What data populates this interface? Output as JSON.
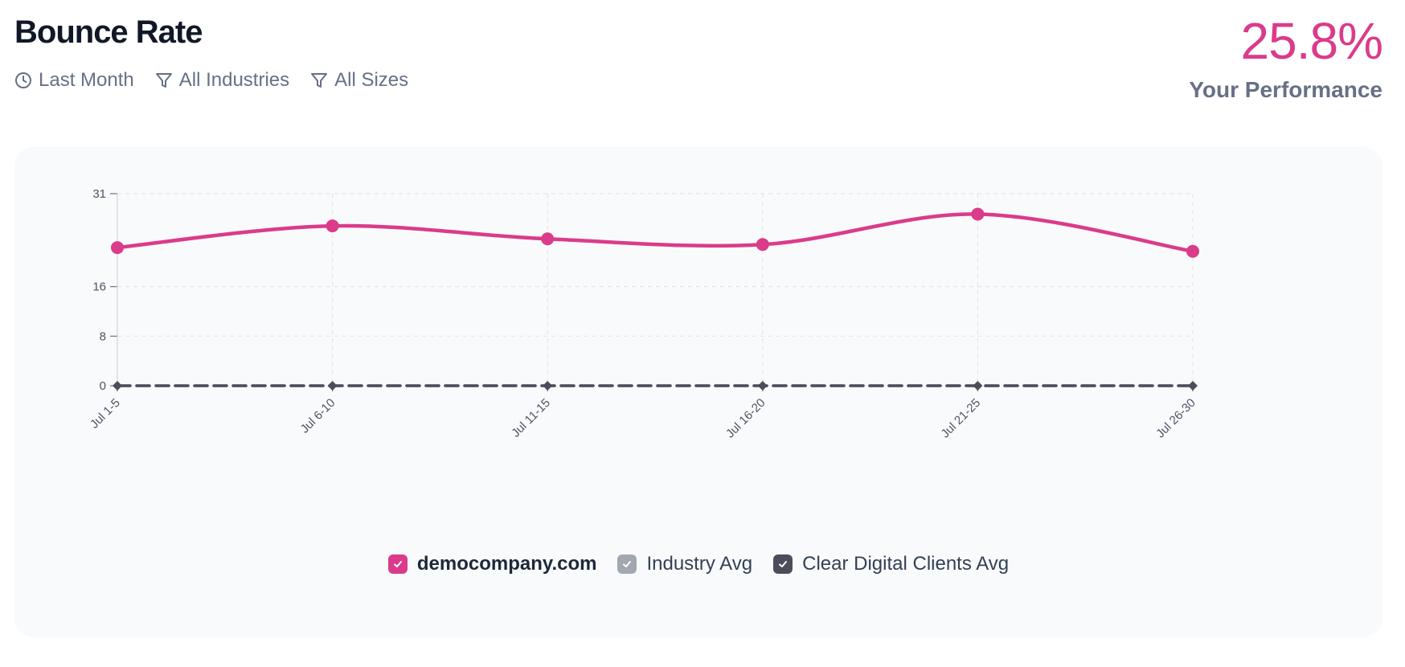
{
  "header": {
    "title": "Bounce Rate",
    "filters": {
      "period": "Last Month",
      "industry": "All Industries",
      "size": "All Sizes"
    },
    "score": "25.8%",
    "score_label": "Your Performance"
  },
  "legend": {
    "items": [
      {
        "label": "democompany.com",
        "color": "#db3b8b"
      },
      {
        "label": "Industry Avg",
        "color": "#a3a7b0"
      },
      {
        "label": "Clear Digital Clients Avg",
        "color": "#4b4e5a"
      }
    ]
  },
  "colors": {
    "accent": "#db3b8b",
    "muted_text": "#667085"
  },
  "chart_data": {
    "type": "line",
    "categories": [
      "Jul 1-5",
      "Jul 6-10",
      "Jul 11-15",
      "Jul 16-20",
      "Jul 21-25",
      "Jul 26-30"
    ],
    "yticks": [
      0,
      8,
      16,
      31
    ],
    "ylim": [
      0,
      31
    ],
    "grid": true,
    "legend_position": "bottom",
    "series": [
      {
        "name": "democompany.com",
        "values": [
          22.3,
          25.8,
          23.7,
          22.8,
          27.7,
          21.7
        ],
        "color": "#db3b8b",
        "style": "smooth"
      },
      {
        "name": "Industry Avg",
        "values": [
          0,
          0,
          0,
          0,
          0,
          0
        ],
        "color": "#a3a7b0",
        "style": "dashed"
      },
      {
        "name": "Clear Digital Clients Avg",
        "values": [
          0,
          0,
          0,
          0,
          0,
          0
        ],
        "color": "#4b4e5a",
        "style": "dashed"
      }
    ]
  }
}
